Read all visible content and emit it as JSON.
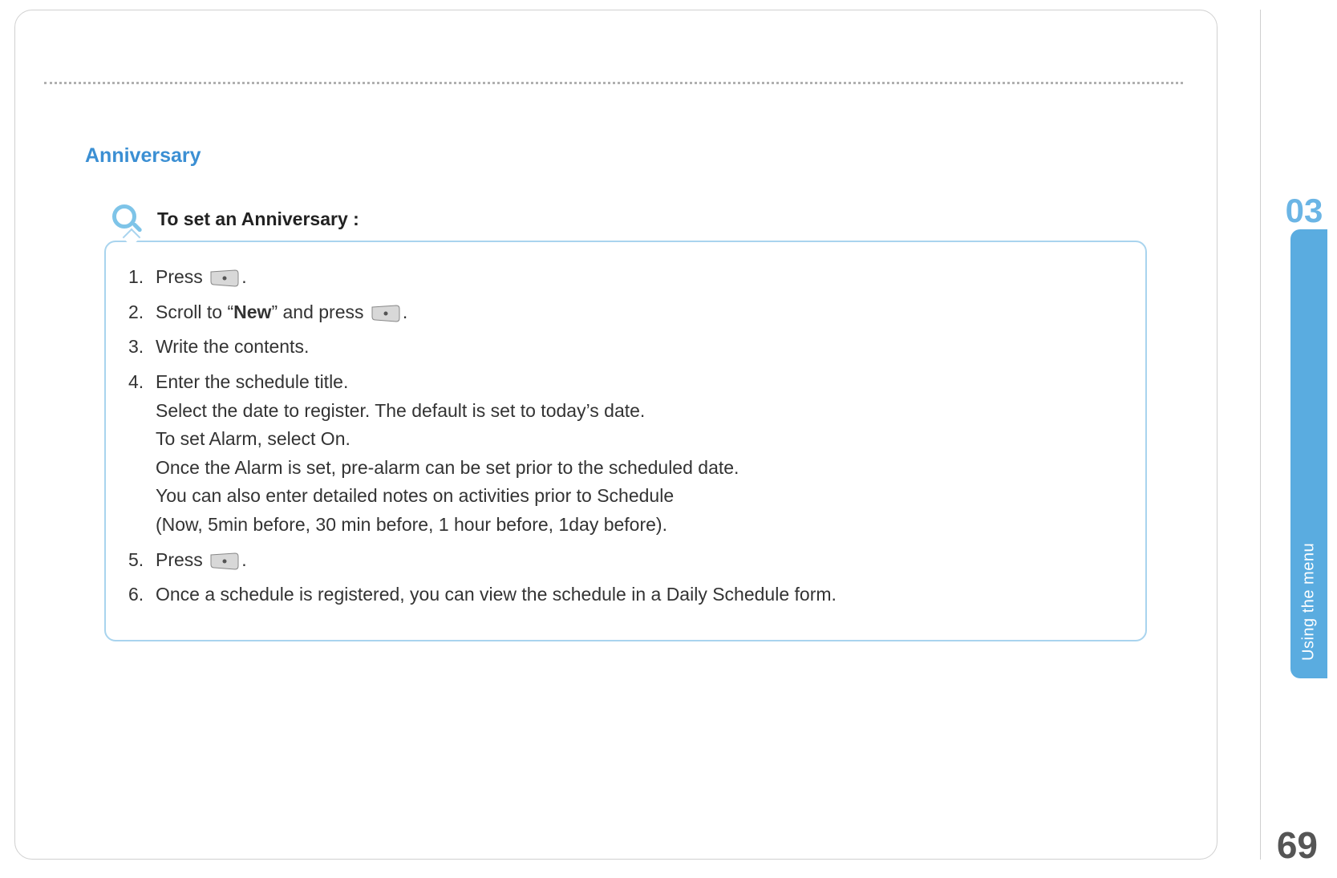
{
  "section_title": "Anniversary",
  "callout_title": "To set an Anniversary :",
  "steps": {
    "s1_num": "1.",
    "s1_a": "Press ",
    "s1_b": ".",
    "s2_num": "2.",
    "s2_a": " Scroll to “",
    "s2_bold": "New",
    "s2_b": "” and press ",
    "s2_c": ".",
    "s3_num": "3.",
    "s3_a": " Write the contents.",
    "s4_num": "4.",
    "s4_l1": "Enter the schedule title.",
    "s4_l2": "Select the date to register. The default is set to today’s date.",
    "s4_l3": "To set Alarm, select On.",
    "s4_l4": "Once the Alarm is set, pre-alarm can be set prior to the scheduled date.",
    "s4_l5": "You can also enter detailed notes on activities prior to Schedule",
    "s4_l6": "(Now, 5min before, 30 min before, 1 hour before, 1day before).",
    "s5_num": "5.",
    "s5_a": "Press ",
    "s5_b": ".",
    "s6_num": "6.",
    "s6_a": "Once a schedule is registered, you can view the schedule in a Daily Schedule form."
  },
  "side_tab": {
    "chapter_number": "03",
    "label": "Using the menu"
  },
  "page_number": "69"
}
